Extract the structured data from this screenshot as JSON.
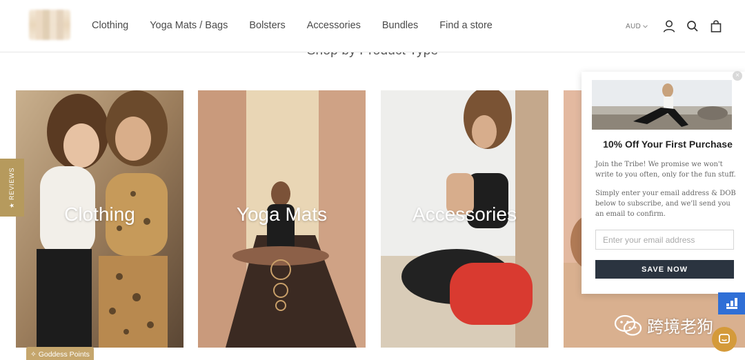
{
  "header": {
    "nav": [
      "Clothing",
      "Yoga Mats / Bags",
      "Bolsters",
      "Accessories",
      "Bundles",
      "Find a store"
    ],
    "currency": "AUD",
    "icons": [
      "account-icon",
      "search-icon",
      "cart-icon"
    ]
  },
  "section": {
    "title": "Shop by Product Type"
  },
  "tiles": [
    {
      "label": "Clothing"
    },
    {
      "label": "Yoga Mats"
    },
    {
      "label": "Accessories"
    },
    {
      "label": ""
    }
  ],
  "reviews_tab": {
    "label": "★ REVIEWS"
  },
  "goddess_points": {
    "label": "✧ Goddess Points"
  },
  "popup": {
    "title": "10% Off Your First Purchase",
    "text1": "Join the Tribe! We promise we won't write to you often, only for the fun stuff.",
    "text2": "Simply enter your email address & DOB below to subscribe, and we'll send you an email to confirm.",
    "email_placeholder": "Enter your email address",
    "button": "SAVE NOW",
    "close": "×"
  },
  "watermark": {
    "text": "跨境老狗"
  },
  "colors": {
    "accent_gold": "#b69a5d",
    "button_dark": "#2b3440",
    "widget_blue": "#2f6fd6"
  }
}
